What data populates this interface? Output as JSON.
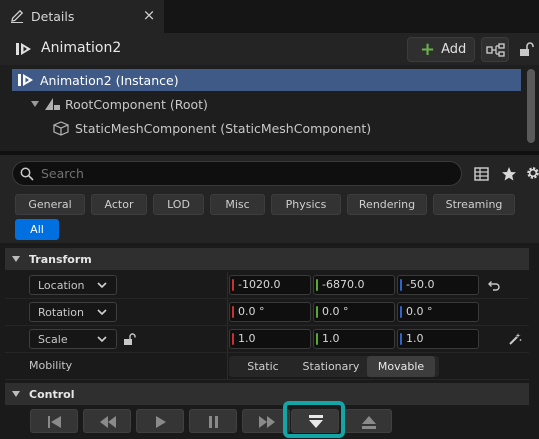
{
  "tab": {
    "title": "Details",
    "close": "×"
  },
  "header": {
    "title": "Animation2",
    "add_label": "Add"
  },
  "tree": {
    "items": [
      {
        "label": "Animation2 (Instance)"
      },
      {
        "label": "RootComponent (Root)"
      },
      {
        "label": "StaticMeshComponent (StaticMeshComponent)"
      }
    ]
  },
  "search": {
    "placeholder": "Search"
  },
  "filters": [
    "General",
    "Actor",
    "LOD",
    "Misc",
    "Physics",
    "Rendering",
    "Streaming",
    "All"
  ],
  "transform": {
    "title": "Transform",
    "location": {
      "label": "Location",
      "x": "-1020.0",
      "y": "-6870.0",
      "z": "-50.0"
    },
    "rotation": {
      "label": "Rotation",
      "x": "0.0 °",
      "y": "0.0 °",
      "z": "0.0 °"
    },
    "scale": {
      "label": "Scale",
      "x": "1.0",
      "y": "1.0",
      "z": "1.0"
    },
    "mobility": {
      "label": "Mobility",
      "options": [
        "Static",
        "Stationary",
        "Movable"
      ],
      "selected": "Movable"
    }
  },
  "control": {
    "title": "Control"
  },
  "colors": {
    "accent": "#0070e0",
    "selection": "#3f5a86",
    "highlight": "#14a6a6",
    "axis_x": "#c83232",
    "axis_y": "#5aa832",
    "axis_z": "#3264c8"
  },
  "icons": [
    "pencil-icon",
    "close-icon",
    "actor-icon",
    "plus-icon",
    "blueprint-icon",
    "lock-icon",
    "search-icon",
    "table-icon",
    "star-icon",
    "gear-icon",
    "reset-arrow-icon",
    "magic-icon",
    "go-to-start-icon",
    "rewind-icon",
    "play-icon",
    "pause-icon",
    "fast-forward-icon",
    "eject-down-icon",
    "eject-up-icon"
  ]
}
